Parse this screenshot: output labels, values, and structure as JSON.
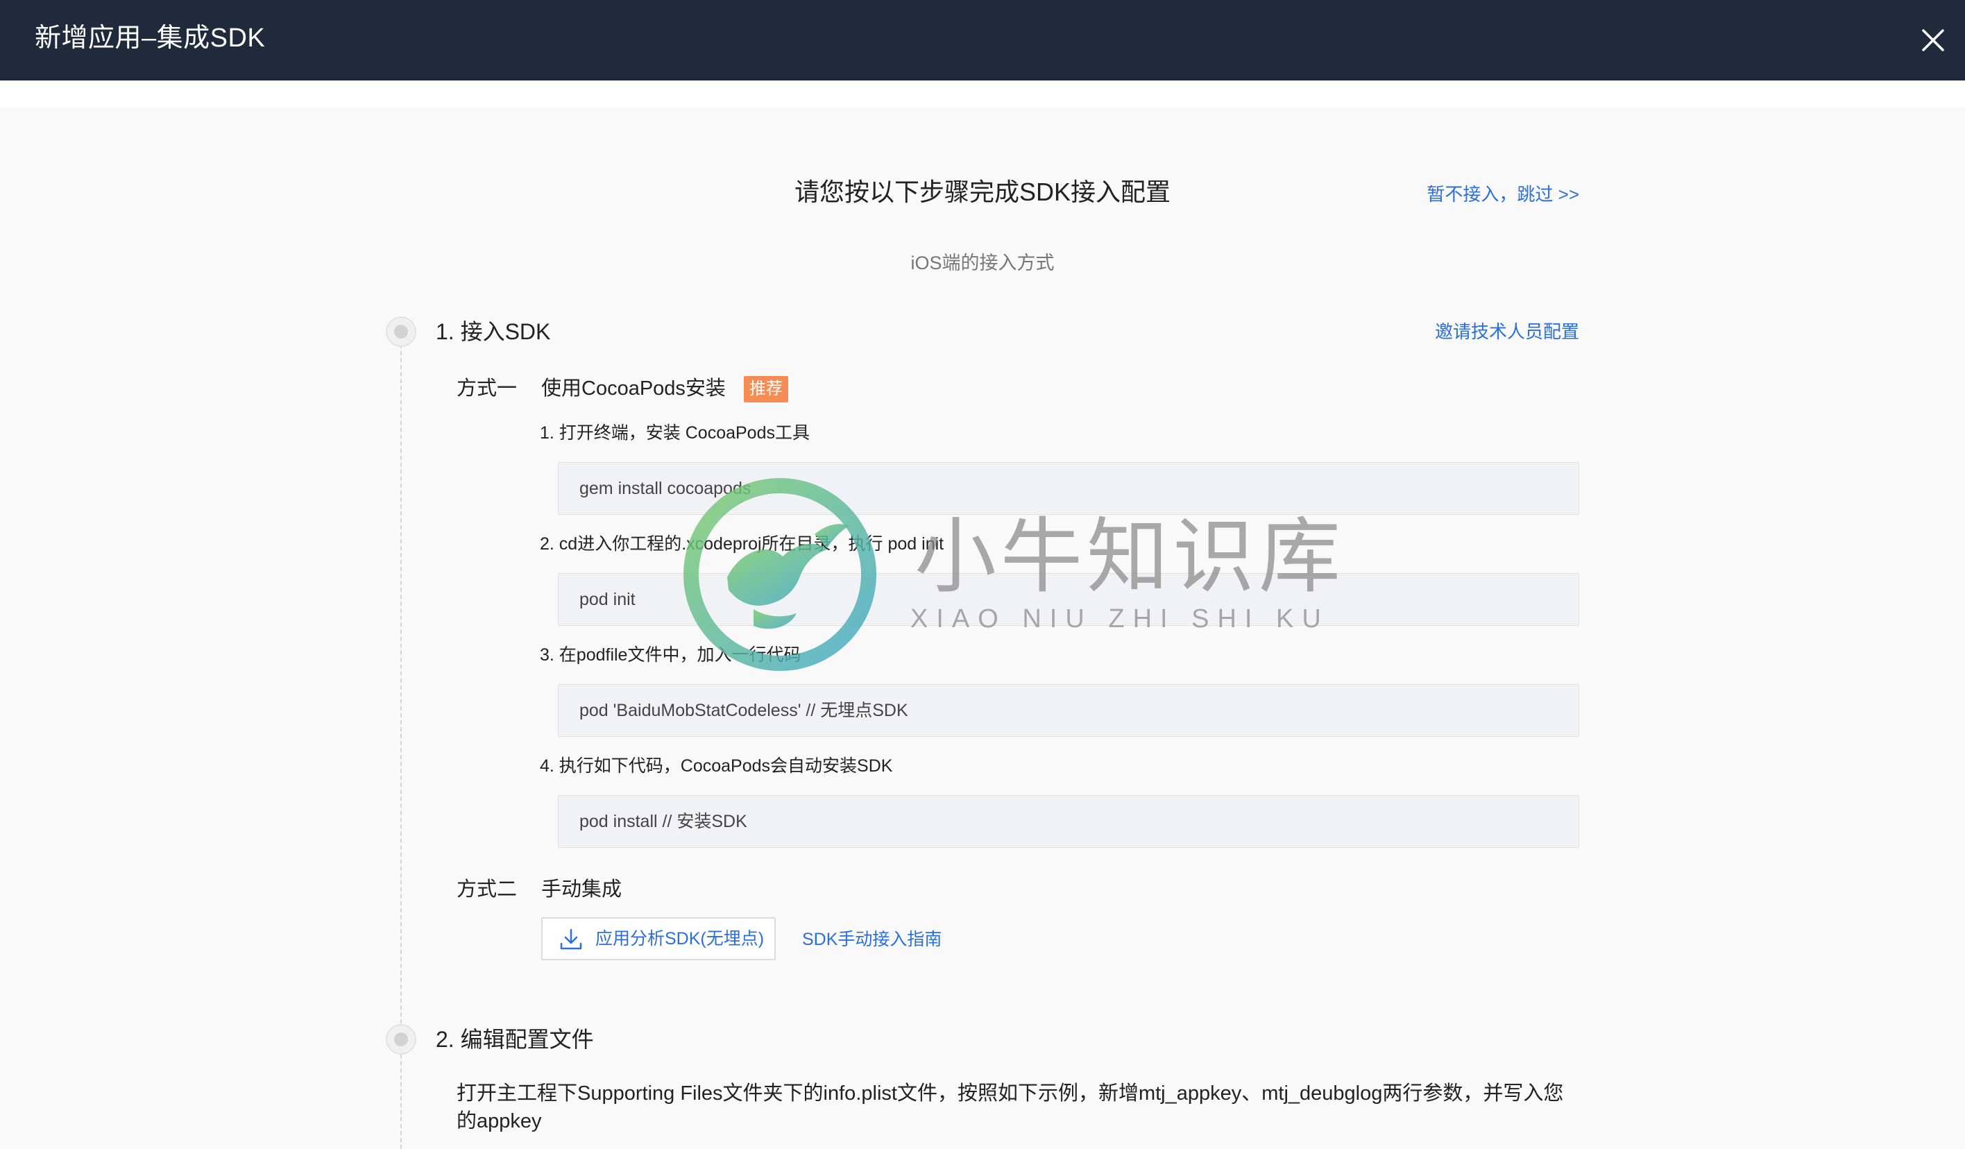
{
  "header": {
    "title": "新增应用–集成SDK"
  },
  "intro": {
    "title": "请您按以下步骤完成SDK接入配置",
    "skip_link": "暂不接入，跳过 >>",
    "platform_subtitle": "iOS端的接入方式"
  },
  "step1": {
    "title": "1. 接入SDK",
    "invite_link": "邀请技术人员配置",
    "method1": {
      "label": "方式一",
      "name": "使用CocoaPods安装",
      "badge": "推荐",
      "instructions": [
        {
          "text": "1. 打开终端，安装 CocoaPods工具",
          "code": "gem install cocoapods"
        },
        {
          "text": "2. cd进入你工程的.xcodeproj所在目录，执行 pod init",
          "code": "pod init"
        },
        {
          "text": "3. 在podfile文件中，加入一行代码",
          "code": "pod 'BaiduMobStatCodeless' // 无埋点SDK"
        },
        {
          "text": "4. 执行如下代码，CocoaPods会自动安装SDK",
          "code": "pod install // 安装SDK"
        }
      ]
    },
    "method2": {
      "label": "方式二",
      "name": "手动集成",
      "download_button": "应用分析SDK(无埋点)",
      "guide_link": "SDK手动接入指南"
    }
  },
  "step2": {
    "title": "2. 编辑配置文件",
    "description": "打开主工程下Supporting Files文件夹下的info.plist文件，按照如下示例，新增mtj_appkey、mtj_deubglog两行参数，并写入您的appkey"
  },
  "watermark": {
    "text_cn": "小牛知识库",
    "text_en": "XIAO NIU ZHI SHI KU"
  },
  "icons": {
    "close": "close-icon",
    "download": "download-icon",
    "step_marker": "step-dot-icon",
    "watermark_logo": "bull-logo-icon"
  },
  "colors": {
    "header_bg": "#212a3c",
    "link": "#2b6fde",
    "badge_bg": "#f58c53",
    "code_bg": "#f1f2f5",
    "panel_bg": "#f9f9f9"
  }
}
